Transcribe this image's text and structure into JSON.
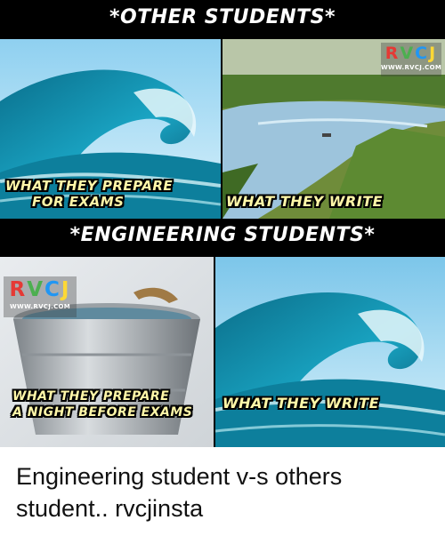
{
  "meme": {
    "top_heading": "*OTHER STUDENTS*",
    "middle_heading": "*ENGINEERING STUDENTS*",
    "panel1": {
      "caption_line1": "WHAT THEY PREPARE",
      "caption_line2": "FOR EXAMS"
    },
    "panel2": {
      "caption": "WHAT THEY WRITE"
    },
    "panel3": {
      "caption_line1": "WHAT THEY PREPARE",
      "caption_line2": "A NIGHT BEFORE EXAMS"
    },
    "panel4": {
      "caption": "WHAT THEY WRITE"
    },
    "logo": {
      "letters": [
        "R",
        "V",
        "C",
        "J"
      ],
      "site": "WWW.RVCJ.COM"
    }
  },
  "post": {
    "text": "Engineering student v-s others student.. rvcjinsta"
  },
  "colors": {
    "caption_text": "#fff7a8",
    "logo_r": "#e53935",
    "logo_v": "#4caf50",
    "logo_c": "#2196f3",
    "logo_j": "#fdd835",
    "band_background": "#000000"
  },
  "icons": [
    "ocean-wave-image",
    "river-landscape-image",
    "water-bucket-image",
    "ocean-wave-image"
  ]
}
